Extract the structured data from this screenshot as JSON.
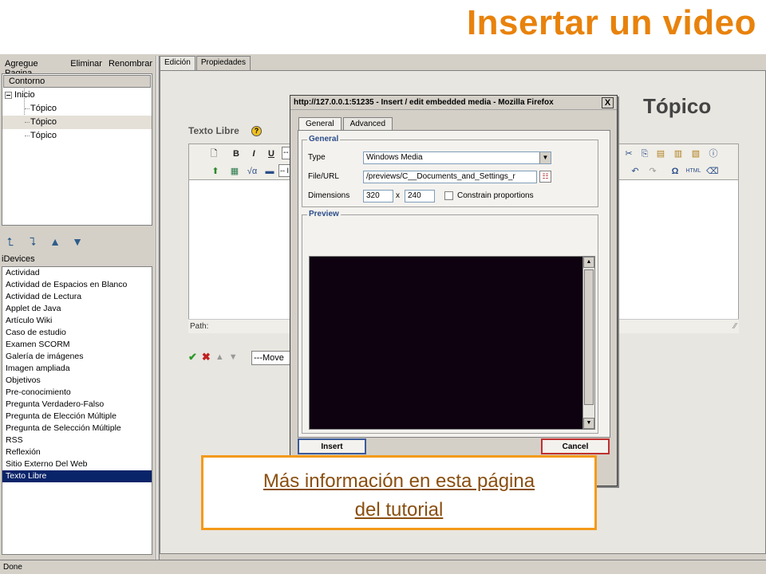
{
  "slide": {
    "title": "Insertar un video"
  },
  "left_pane": {
    "menu": [
      "Agregue Pagina",
      "Eliminar",
      "Renombrar"
    ],
    "outline_header": "Contorno",
    "tree": [
      {
        "label": "Inicio",
        "level": 0
      },
      {
        "label": "Tópico",
        "level": 1
      },
      {
        "label": "Tópico",
        "level": 1,
        "selected": true
      },
      {
        "label": "Tópico",
        "level": 1
      }
    ],
    "idevices_label": "iDevices",
    "idevices": [
      "Actividad",
      "Actividad de Espacios en Blanco",
      "Actividad de Lectura",
      "Applet de Java",
      "Artículo Wiki",
      "Caso de estudio",
      "Examen SCORM",
      "Galería de imágenes",
      "Imagen ampliada",
      "Objetivos",
      "Pre-conocimiento",
      "Pregunta Verdadero-Falso",
      "Pregunta de Elección Múltiple",
      "Pregunta de Selección Múltiple",
      "RSS",
      "Reflexión",
      "Sitio Externo Del Web",
      "Texto Libre"
    ],
    "selected_idevice": "Texto Libre"
  },
  "tabs": [
    "Edición",
    "Propiedades"
  ],
  "editor": {
    "page_heading": "Tópico",
    "idevice_title": "Texto Libre",
    "toolbar_select_1": "--",
    "toolbar_select_2": "-- I",
    "path_label": "Path:",
    "move_select": "---Move"
  },
  "dialog": {
    "title": "http://127.0.0.1:51235 - Insert / edit embedded media - Mozilla Firefox",
    "close": "X",
    "tabs": [
      "General",
      "Advanced"
    ],
    "general_legend": "General",
    "type_label": "Type",
    "type_value": "Windows Media",
    "file_label": "File/URL",
    "file_value": "/previews/C__Documents_and_Settings_r",
    "dimensions_label": "Dimensions",
    "width": "320",
    "height": "240",
    "times": "x",
    "constrain_label": "Constrain proportions",
    "preview_legend": "Preview",
    "insert_button": "Insert",
    "cancel_button": "Cancel"
  },
  "callout": {
    "line1": "Más información en esta página",
    "line2": "del tutorial"
  },
  "status": "Done",
  "colors": {
    "title": "#e8820c",
    "callout_border": "#f39a1a",
    "selection": "#0a246a",
    "legend": "#2b4e8a"
  }
}
